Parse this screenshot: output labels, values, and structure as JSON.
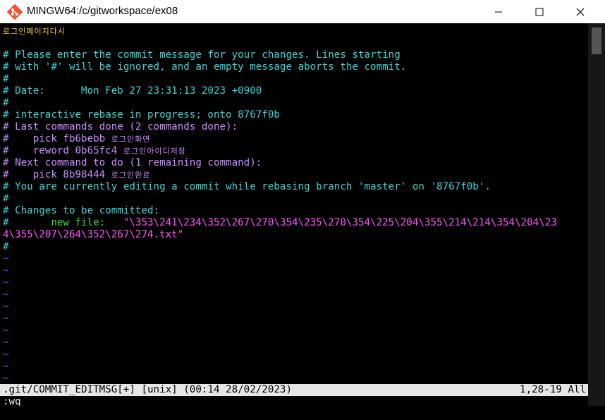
{
  "window": {
    "title": "MINGW64:/c/gitworkspace/ex08",
    "icon": "git-icon",
    "controls": [
      "minimize-icon",
      "maximize-icon",
      "close-icon"
    ]
  },
  "lines": [
    {
      "segments": [
        {
          "text": "로그인페이지다시",
          "color": "yellow",
          "korean": true
        }
      ]
    },
    {
      "segments": [
        {
          "text": "",
          "color": "teal"
        }
      ]
    },
    {
      "segments": [
        {
          "text": "# Please enter the commit message for your changes. Lines starting",
          "color": "teal"
        }
      ]
    },
    {
      "segments": [
        {
          "text": "# with '#' will be ignored, and an empty message aborts the commit.",
          "color": "teal"
        }
      ]
    },
    {
      "segments": [
        {
          "text": "#",
          "color": "teal"
        }
      ]
    },
    {
      "segments": [
        {
          "text": "# Date:      Mon Feb 27 23:31:13 2023 +0900",
          "color": "teal"
        }
      ]
    },
    {
      "segments": [
        {
          "text": "#",
          "color": "teal"
        }
      ]
    },
    {
      "segments": [
        {
          "text": "# interactive rebase in progress; onto 8767f0b",
          "color": "teal"
        }
      ]
    },
    {
      "segments": [
        {
          "text": "# Last commands done (2 commands done):",
          "color": "purple"
        }
      ]
    },
    {
      "segments": [
        {
          "text": "#    pick fb6bebb ",
          "color": "purple"
        },
        {
          "text": "로그인화면",
          "color": "purple",
          "korean": true
        }
      ]
    },
    {
      "segments": [
        {
          "text": "#    reword 0b65fc4 ",
          "color": "purple"
        },
        {
          "text": "로그인아이디저장",
          "color": "purple",
          "korean": true
        }
      ]
    },
    {
      "segments": [
        {
          "text": "# Next command to do (1 remaining command):",
          "color": "purple"
        }
      ]
    },
    {
      "segments": [
        {
          "text": "#    pick 8b98444 ",
          "color": "purple"
        },
        {
          "text": "로그인완료",
          "color": "purple",
          "korean": true
        }
      ]
    },
    {
      "segments": [
        {
          "text": "# You are currently editing a commit while rebasing branch 'master' on '8767f0b'.",
          "color": "teal"
        }
      ]
    },
    {
      "segments": [
        {
          "text": "#",
          "color": "teal"
        }
      ]
    },
    {
      "segments": [
        {
          "text": "# Changes to be committed:",
          "color": "teal"
        }
      ]
    },
    {
      "segments": [
        {
          "text": "#",
          "color": "teal"
        },
        {
          "text": "       new file:   ",
          "color": "green"
        },
        {
          "text": "\"\\353\\241\\234\\352\\267\\270\\354\\235\\270\\354\\225\\204\\355\\214\\214\\354\\204\\23",
          "color": "pink"
        }
      ]
    },
    {
      "segments": [
        {
          "text": "4\\355\\207\\264\\352\\267\\274.txt\"",
          "color": "pink"
        }
      ]
    },
    {
      "segments": [
        {
          "text": "#",
          "color": "teal"
        }
      ]
    },
    {
      "segments": [
        {
          "text": "~",
          "color": "tilde"
        }
      ]
    },
    {
      "segments": [
        {
          "text": "~",
          "color": "tilde"
        }
      ]
    },
    {
      "segments": [
        {
          "text": "~",
          "color": "tilde"
        }
      ]
    },
    {
      "segments": [
        {
          "text": "~",
          "color": "tilde"
        }
      ]
    },
    {
      "segments": [
        {
          "text": "~",
          "color": "tilde"
        }
      ]
    },
    {
      "segments": [
        {
          "text": "~",
          "color": "tilde"
        }
      ]
    },
    {
      "segments": [
        {
          "text": "~",
          "color": "tilde"
        }
      ]
    },
    {
      "segments": [
        {
          "text": "~",
          "color": "tilde"
        }
      ]
    },
    {
      "segments": [
        {
          "text": "~",
          "color": "tilde"
        }
      ]
    },
    {
      "segments": [
        {
          "text": "~",
          "color": "tilde"
        }
      ]
    },
    {
      "segments": [
        {
          "text": "~",
          "color": "tilde"
        }
      ]
    }
  ],
  "status": {
    "left": ".git/COMMIT_EDITMSG[+] [unix] (00:14 28/02/2023)",
    "right": "1,28-19 All"
  },
  "command_line": ":wq",
  "colors": {
    "yellow": "#f0d020",
    "teal": "#3fd3d3",
    "purple": "#c88cff",
    "green": "#33e033",
    "pink": "#ff55ff",
    "tilde": "#3f72ff",
    "background": "#000000",
    "status_bg": "#e6e6e6"
  }
}
